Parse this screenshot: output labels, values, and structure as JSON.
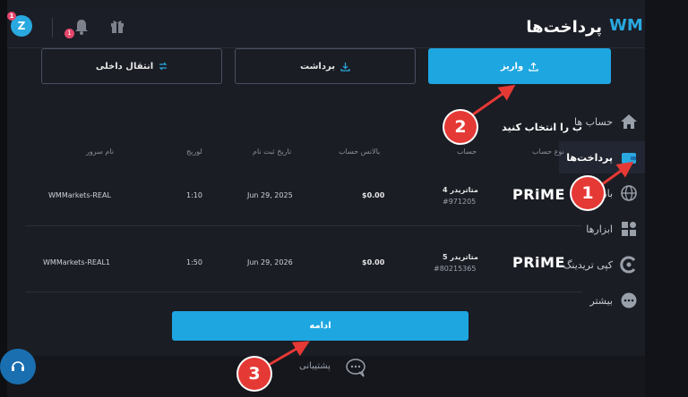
{
  "header": {
    "title": "پرداخت‌ها",
    "logo": "WM",
    "avatar_letter": "Z",
    "avatar_badge": "1",
    "bell_badge": "1"
  },
  "sidebar": {
    "items": [
      {
        "label": "حساب ها",
        "icon": "home-icon"
      },
      {
        "label": "پرداخت‌ها",
        "icon": "wallet-icon"
      },
      {
        "label": "بازار",
        "icon": "globe-icon"
      },
      {
        "label": "ابزارها",
        "icon": "tools-icon"
      },
      {
        "label": "کپی تریدینگ",
        "icon": "copy-trading-icon"
      },
      {
        "label": "بیشتر",
        "icon": "more-icon"
      }
    ]
  },
  "actions": {
    "deposit": "واریز",
    "withdraw": "برداشت",
    "transfer": "انتقال داخلی"
  },
  "select_title": "ب را انتخاب کنید",
  "table": {
    "headers": {
      "account_type": "نوع حساب",
      "account": "حساب",
      "balance": "بالانس حساب",
      "reg_date": "تاریخ ثبت نام",
      "leverage": "لوریج",
      "server": "نام سرور"
    },
    "rows": [
      {
        "brand": "PRiME",
        "trader": "متاتریدر 4",
        "number": "#971205",
        "balance": "$0.00",
        "date": "Jun 29, 2025",
        "leverage": "1:10",
        "server": "WMMarkets-REAL"
      },
      {
        "brand": "PRiME",
        "trader": "متاتریدر 5",
        "number": "#80215365",
        "balance": "$0.00",
        "date": "Jun 29, 2026",
        "leverage": "1:50",
        "server": "WMMarkets-REAL1"
      }
    ]
  },
  "continue_label": "ادامه",
  "support_label": "پشتیبانی",
  "annotations": [
    "1",
    "2",
    "3"
  ],
  "colors": {
    "accent": "#1ea6e0",
    "marker": "#e53935"
  }
}
